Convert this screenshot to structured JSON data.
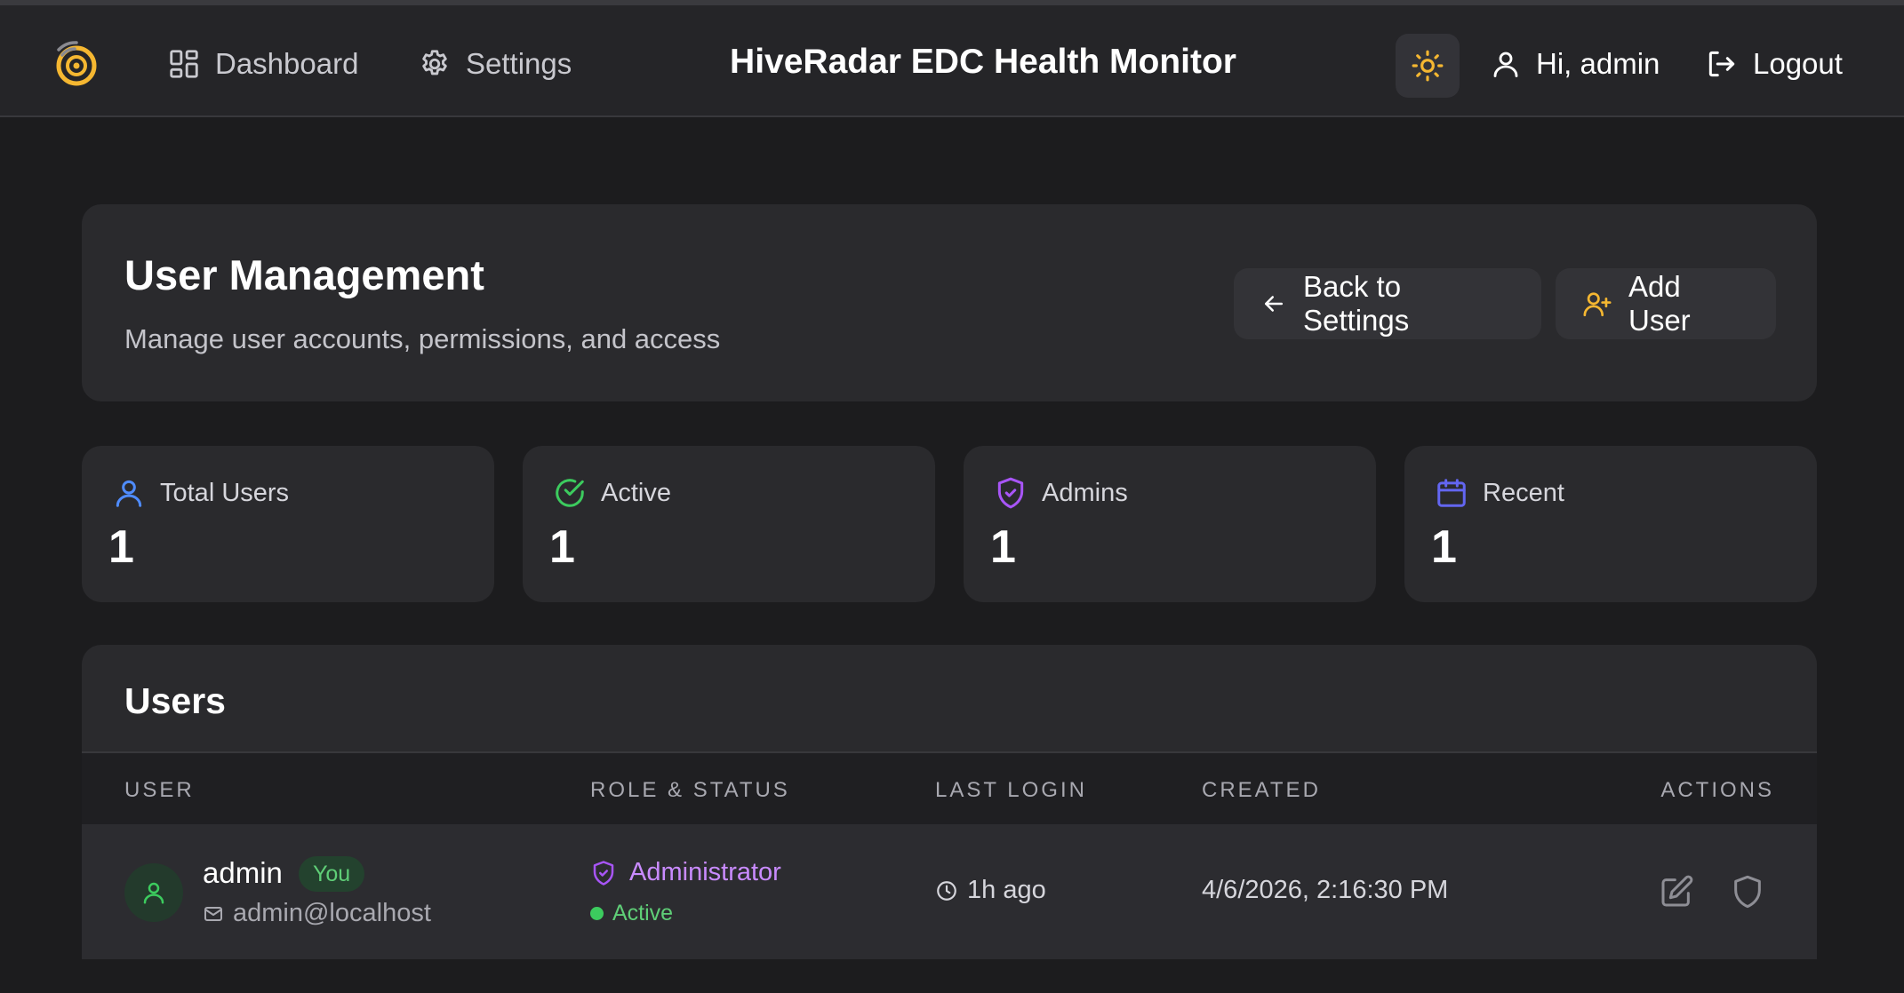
{
  "nav": {
    "dashboard_label": "Dashboard",
    "settings_label": "Settings",
    "app_title": "HiveRadar EDC Health Monitor",
    "greeting": "Hi, admin",
    "logout_label": "Logout"
  },
  "page": {
    "title": "User Management",
    "subtitle": "Manage user accounts, permissions, and access",
    "back_label": "Back to Settings",
    "add_user_label": "Add User"
  },
  "stats": [
    {
      "label": "Total Users",
      "value": "1",
      "icon": "users-icon",
      "color": "#4f8cff"
    },
    {
      "label": "Active",
      "value": "1",
      "icon": "check-circle-icon",
      "color": "#3ccb5e"
    },
    {
      "label": "Admins",
      "value": "1",
      "icon": "shield-icon",
      "color": "#a855f7"
    },
    {
      "label": "Recent",
      "value": "1",
      "icon": "calendar-icon",
      "color": "#6366f1"
    }
  ],
  "users_table": {
    "title": "Users",
    "columns": [
      "USER",
      "ROLE & STATUS",
      "LAST LOGIN",
      "CREATED",
      "ACTIONS"
    ],
    "rows": [
      {
        "username": "admin",
        "badge": "You",
        "email": "admin@localhost",
        "role": "Administrator",
        "status": "Active",
        "last_login": "1h ago",
        "created": "4/6/2026, 2:16:30 PM"
      }
    ]
  },
  "colors": {
    "accent_yellow": "#f5b731",
    "admin_purple": "#c98bff",
    "active_green": "#3ccb5e"
  }
}
